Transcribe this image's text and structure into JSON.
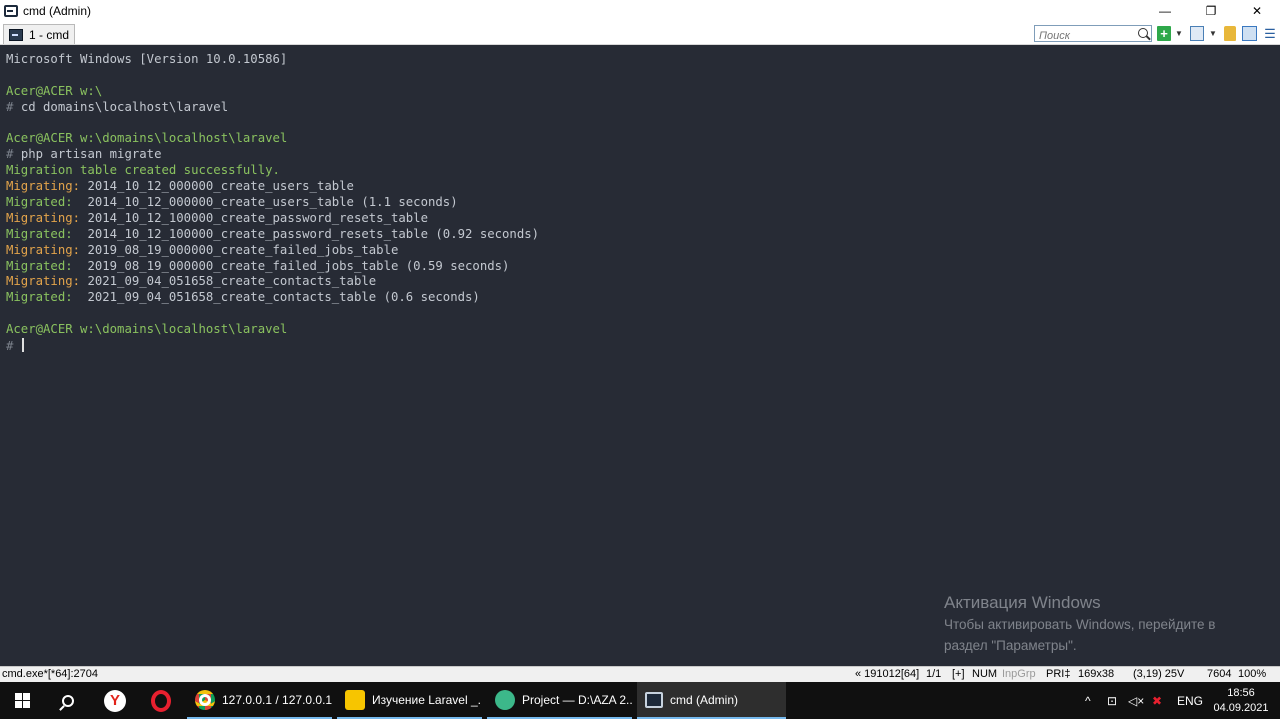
{
  "window": {
    "title": "cmd (Admin)",
    "controls": {
      "minimize": "—",
      "restore": "❐",
      "close": "✕"
    }
  },
  "tabbar": {
    "tab_label": "1 - cmd",
    "search_placeholder": "Поиск",
    "new_console": "+",
    "dropdown": "▼"
  },
  "console": {
    "lines": [
      {
        "segments": [
          {
            "text": "Microsoft Windows [Version 10.0.10586]",
            "color": "gray"
          }
        ]
      },
      {
        "segments": []
      },
      {
        "segments": [
          {
            "text": "Acer@ACER w:\\",
            "color": "green"
          }
        ]
      },
      {
        "segments": [
          {
            "text": "# ",
            "color": "dim"
          },
          {
            "text": "cd domains\\localhost\\laravel",
            "color": "gray"
          }
        ]
      },
      {
        "segments": []
      },
      {
        "segments": [
          {
            "text": "Acer@ACER w:\\domains\\localhost\\laravel",
            "color": "green"
          }
        ]
      },
      {
        "segments": [
          {
            "text": "# ",
            "color": "dim"
          },
          {
            "text": "php artisan migrate",
            "color": "gray"
          }
        ]
      },
      {
        "segments": [
          {
            "text": "Migration table created successfully.",
            "color": "green"
          }
        ]
      },
      {
        "segments": [
          {
            "text": "Migrating: ",
            "color": "orange"
          },
          {
            "text": "2014_10_12_000000_create_users_table",
            "color": "gray"
          }
        ]
      },
      {
        "segments": [
          {
            "text": "Migrated:  ",
            "color": "green"
          },
          {
            "text": "2014_10_12_000000_create_users_table (1.1 seconds)",
            "color": "gray"
          }
        ]
      },
      {
        "segments": [
          {
            "text": "Migrating: ",
            "color": "orange"
          },
          {
            "text": "2014_10_12_100000_create_password_resets_table",
            "color": "gray"
          }
        ]
      },
      {
        "segments": [
          {
            "text": "Migrated:  ",
            "color": "green"
          },
          {
            "text": "2014_10_12_100000_create_password_resets_table (0.92 seconds)",
            "color": "gray"
          }
        ]
      },
      {
        "segments": [
          {
            "text": "Migrating: ",
            "color": "orange"
          },
          {
            "text": "2019_08_19_000000_create_failed_jobs_table",
            "color": "gray"
          }
        ]
      },
      {
        "segments": [
          {
            "text": "Migrated:  ",
            "color": "green"
          },
          {
            "text": "2019_08_19_000000_create_failed_jobs_table (0.59 seconds)",
            "color": "gray"
          }
        ]
      },
      {
        "segments": [
          {
            "text": "Migrating: ",
            "color": "orange"
          },
          {
            "text": "2021_09_04_051658_create_contacts_table",
            "color": "gray"
          }
        ]
      },
      {
        "segments": [
          {
            "text": "Migrated:  ",
            "color": "green"
          },
          {
            "text": "2021_09_04_051658_create_contacts_table (0.6 seconds)",
            "color": "gray"
          }
        ]
      },
      {
        "segments": []
      },
      {
        "segments": [
          {
            "text": "Acer@ACER w:\\domains\\localhost\\laravel",
            "color": "green"
          }
        ]
      },
      {
        "segments": [
          {
            "text": "# ",
            "color": "dim"
          }
        ],
        "cursor": true
      }
    ]
  },
  "watermark": {
    "title": "Активация Windows",
    "line1": "Чтобы активировать Windows, перейдите в",
    "line2": "раздел \"Параметры\"."
  },
  "statusbar": {
    "process": "cmd.exe*[*64]:2704",
    "build": "« 191012[64]",
    "pages": "1/1",
    "plus": "[+]",
    "num": "NUM",
    "inpgrp": "InpGrp",
    "pri": "PRI‡",
    "size": "169x38",
    "cursor_pos": "(3,19) 25V",
    "pid": "7604",
    "zoom": "100%"
  },
  "taskbar": {
    "yandex_letter": "Y",
    "tasks": [
      {
        "label": "127.0.0.1 / 127.0.0.1..."
      },
      {
        "label": "Изучение Laravel _..."
      },
      {
        "label": "Project — D:\\AZA 2..."
      },
      {
        "label": "cmd (Admin)"
      }
    ],
    "tray": {
      "chevron": "^",
      "network": "⊡",
      "volume": "◁×",
      "battery": "✖",
      "language": "ENG",
      "time": "18:56",
      "date": "04.09.2021"
    }
  },
  "colors": {
    "console_bg": "#272b35",
    "gray": "#c3c8d0",
    "green": "#8ac25f",
    "orange": "#e3a44b",
    "dim": "#7b818b"
  }
}
